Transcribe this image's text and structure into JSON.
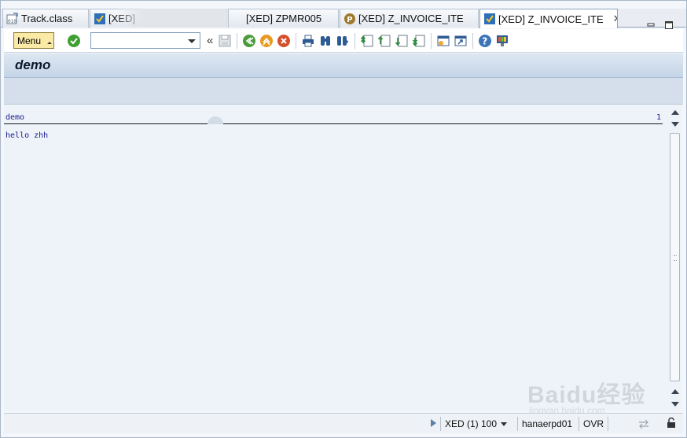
{
  "tabs": [
    {
      "label": "Track.class",
      "icon": "java-class-icon",
      "active": false
    },
    {
      "label": "[XED]",
      "icon": "sap-program-icon",
      "active": false
    },
    {
      "label": "[XED] ZPMR005",
      "icon": "sap-program-icon",
      "active": false
    },
    {
      "label": "[XED] Z_INVOICE_ITE",
      "icon": "sap-package-icon",
      "active": false
    },
    {
      "label": "[XED] Z_INVOICE_ITE",
      "icon": "sap-program-icon",
      "active": true,
      "close": "✕"
    }
  ],
  "toolbar": {
    "menu_label": "Menu",
    "command_placeholder": "",
    "collapse_glyph": "«",
    "icons": [
      "enter-icon",
      "save-icon",
      "back-icon",
      "exit-icon",
      "cancel-icon",
      "print-icon",
      "find-icon",
      "find-next-icon",
      "first-page-icon",
      "previous-page-icon",
      "next-page-icon",
      "last-page-icon",
      "new-session-icon",
      "shortcut-icon",
      "help-icon",
      "layout-menu-icon"
    ]
  },
  "screen": {
    "title": "demo"
  },
  "list": {
    "header_title": "demo",
    "page_number": "1",
    "lines": [
      "hello zhh"
    ]
  },
  "status": {
    "system": "XED (1) 100",
    "host": "hanaerpd01",
    "mode": "OVR"
  },
  "watermark": {
    "brand": "Baidu经验",
    "url": "jingyan.baidu.com"
  },
  "colors": {
    "menu_button": "#fbe9a6",
    "title_bar": "#c5d5e7",
    "list_background": "#edf3f9",
    "list_text": "#1a1a8a"
  }
}
